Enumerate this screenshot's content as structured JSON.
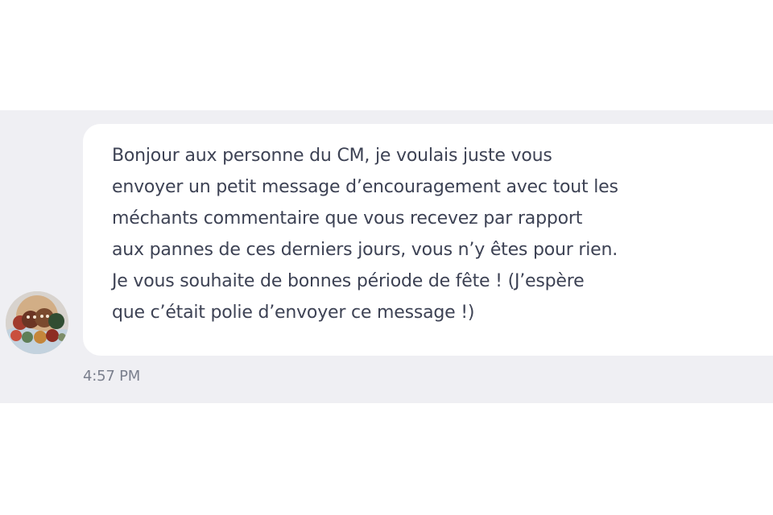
{
  "message": {
    "text": "Bonjour aux personne du CM, je voulais juste vous\nenvoyer un petit message d’encouragement avec tout les\nméchants commentaire que vous recevez par rapport\naux pannes de ces derniers jours, vous n’y êtes pour rien.\nJe vous souhaite de bonnes période de fête ! (J’espère\nque c’était polie d’envoyer ce message !)",
    "timestamp": "4:57 PM"
  },
  "colors": {
    "page_background": "#ffffff",
    "chat_background": "#efeff3",
    "bubble_background": "#ffffff",
    "message_text": "#3d4254",
    "timestamp_text": "#7a7f8d"
  },
  "icons": {
    "avatar": "user-avatar-photo"
  }
}
